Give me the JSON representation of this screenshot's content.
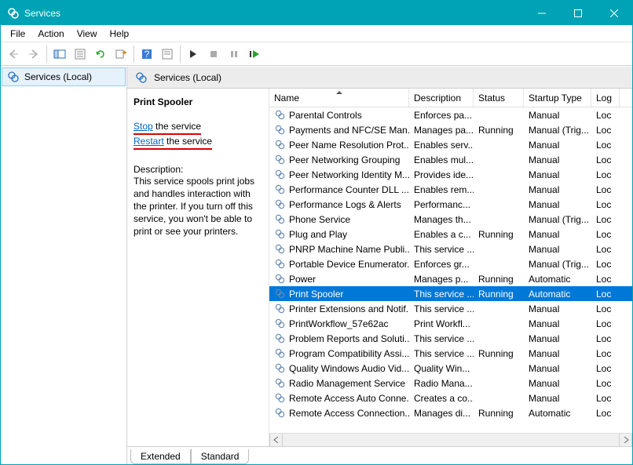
{
  "window": {
    "title": "Services"
  },
  "menu": {
    "file": "File",
    "action": "Action",
    "view": "View",
    "help": "Help"
  },
  "leftpane": {
    "item": "Services (Local)"
  },
  "rightpane_header": "Services (Local)",
  "detail": {
    "name": "Print Spooler",
    "stop_link": "Stop",
    "stop_suffix": " the service",
    "restart_link": "Restart",
    "restart_suffix": " the service",
    "desc_label": "Description:",
    "desc": "This service spools print jobs and handles interaction with the printer. If you turn off this service, you won't be able to print or see your printers."
  },
  "columns": {
    "name": "Name",
    "description": "Description",
    "status": "Status",
    "startup": "Startup Type",
    "logon": "Log"
  },
  "tabs": {
    "extended": "Extended",
    "standard": "Standard"
  },
  "selected_index": 12,
  "services": [
    {
      "name": "Parental Controls",
      "description": "Enforces pa...",
      "status": "",
      "startup": "Manual",
      "logon": "Loc"
    },
    {
      "name": "Payments and NFC/SE Man...",
      "description": "Manages pa...",
      "status": "Running",
      "startup": "Manual (Trig...",
      "logon": "Loc"
    },
    {
      "name": "Peer Name Resolution Prot...",
      "description": "Enables serv...",
      "status": "",
      "startup": "Manual",
      "logon": "Loc"
    },
    {
      "name": "Peer Networking Grouping",
      "description": "Enables mul...",
      "status": "",
      "startup": "Manual",
      "logon": "Loc"
    },
    {
      "name": "Peer Networking Identity M...",
      "description": "Provides ide...",
      "status": "",
      "startup": "Manual",
      "logon": "Loc"
    },
    {
      "name": "Performance Counter DLL ...",
      "description": "Enables rem...",
      "status": "",
      "startup": "Manual",
      "logon": "Loc"
    },
    {
      "name": "Performance Logs & Alerts",
      "description": "Performanc...",
      "status": "",
      "startup": "Manual",
      "logon": "Loc"
    },
    {
      "name": "Phone Service",
      "description": "Manages th...",
      "status": "",
      "startup": "Manual (Trig...",
      "logon": "Loc"
    },
    {
      "name": "Plug and Play",
      "description": "Enables a c...",
      "status": "Running",
      "startup": "Manual",
      "logon": "Loc"
    },
    {
      "name": "PNRP Machine Name Publi...",
      "description": "This service ...",
      "status": "",
      "startup": "Manual",
      "logon": "Loc"
    },
    {
      "name": "Portable Device Enumerator...",
      "description": "Enforces gr...",
      "status": "",
      "startup": "Manual (Trig...",
      "logon": "Loc"
    },
    {
      "name": "Power",
      "description": "Manages p...",
      "status": "Running",
      "startup": "Automatic",
      "logon": "Loc"
    },
    {
      "name": "Print Spooler",
      "description": "This service ...",
      "status": "Running",
      "startup": "Automatic",
      "logon": "Loc"
    },
    {
      "name": "Printer Extensions and Notif...",
      "description": "This service ...",
      "status": "",
      "startup": "Manual",
      "logon": "Loc"
    },
    {
      "name": "PrintWorkflow_57e62ac",
      "description": "Print Workfl...",
      "status": "",
      "startup": "Manual",
      "logon": "Loc"
    },
    {
      "name": "Problem Reports and Soluti...",
      "description": "This service ...",
      "status": "",
      "startup": "Manual",
      "logon": "Loc"
    },
    {
      "name": "Program Compatibility Assi...",
      "description": "This service ...",
      "status": "Running",
      "startup": "Manual",
      "logon": "Loc"
    },
    {
      "name": "Quality Windows Audio Vid...",
      "description": "Quality Win...",
      "status": "",
      "startup": "Manual",
      "logon": "Loc"
    },
    {
      "name": "Radio Management Service",
      "description": "Radio Mana...",
      "status": "",
      "startup": "Manual",
      "logon": "Loc"
    },
    {
      "name": "Remote Access Auto Conne...",
      "description": "Creates a co...",
      "status": "",
      "startup": "Manual",
      "logon": "Loc"
    },
    {
      "name": "Remote Access Connection...",
      "description": "Manages di...",
      "status": "Running",
      "startup": "Automatic",
      "logon": "Loc"
    }
  ]
}
